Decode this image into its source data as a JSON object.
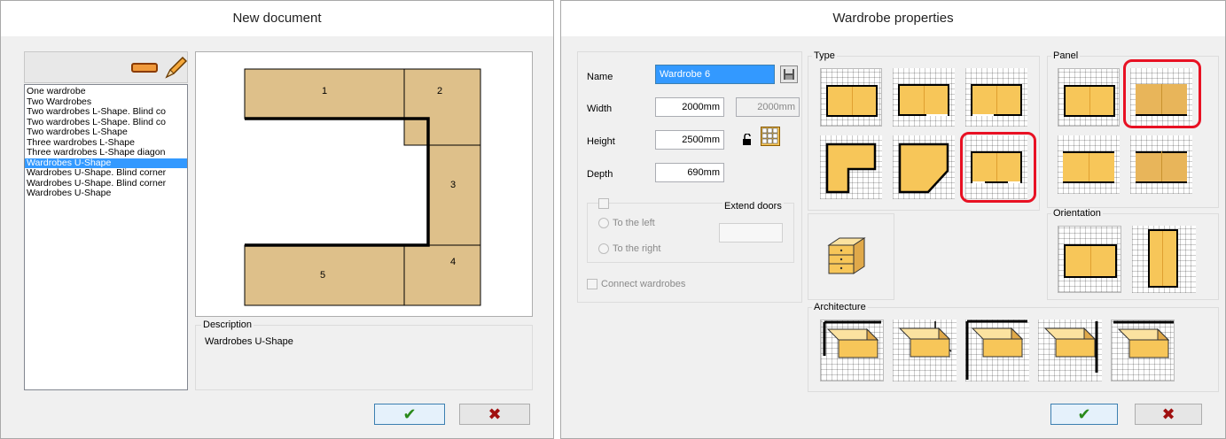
{
  "new_document": {
    "title": "New document",
    "list_items": [
      "One wardrobe",
      "Two Wardrobes",
      "Two wardrobes L-Shape. Blind co",
      "Two wardrobes L-Shape. Blind co",
      "Two wardrobes L-Shape",
      "Three wardrobes L-Shape",
      "Three wardrobes L-Shape diagon",
      "Wardrobes U-Shape",
      "Wardrobes U-Shape. Blind corner",
      "Wardrobes U-Shape. Blind corner",
      "Wardrobes U-Shape"
    ],
    "selected_index": 7,
    "preview_labels": [
      "1",
      "2",
      "3",
      "4",
      "5"
    ],
    "description_label": "Description",
    "description_text": "Wardrobes U-Shape",
    "ok_icon": "check-icon",
    "cancel_icon": "x-icon"
  },
  "wardrobe_properties": {
    "title": "Wardrobe properties",
    "name_label": "Name",
    "name_value": "Wardrobe 6",
    "width_label": "Width",
    "width_value": "2000mm",
    "width_readonly": "2000mm",
    "height_label": "Height",
    "height_value": "2500mm",
    "depth_label": "Depth",
    "depth_value": "690mm",
    "extend_doors_label": "Extend doors",
    "to_left_label": "To the left",
    "to_right_label": "To the right",
    "connect_label": "Connect wardrobes",
    "type_label": "Type",
    "panel_label": "Panel",
    "orientation_label": "Orientation",
    "architecture_label": "Architecture"
  },
  "colors": {
    "accent": "#3399ff",
    "wardrobe_fill": "#f7c659",
    "preview_fill": "#dec08a",
    "selection_red": "#e81123"
  }
}
